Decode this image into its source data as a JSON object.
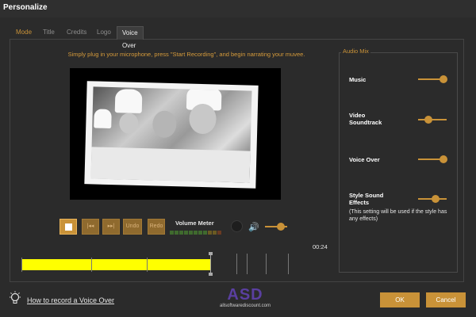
{
  "window": {
    "title": "Personalize"
  },
  "tabs": [
    {
      "label": "Mode"
    },
    {
      "label": "Title"
    },
    {
      "label": "Credits"
    },
    {
      "label": "Logo"
    },
    {
      "label": "Voice Over",
      "active": true
    }
  ],
  "instruction": "Simply plug in your microphone, press \"Start Recording\", and begin narrating your muvee.",
  "transport": {
    "buttons": [
      {
        "icon": "stop-icon",
        "label": ""
      },
      {
        "icon": "rewind-icon",
        "label": ""
      },
      {
        "icon": "forward-icon",
        "label": ""
      },
      {
        "icon": "undo-icon",
        "label": "Undo"
      },
      {
        "icon": "redo-icon",
        "label": "Redo"
      }
    ],
    "volume_meter_label": "Volume Meter",
    "volume_level": 0.7,
    "time": "00:24"
  },
  "audio_mix": {
    "title": "Audio Mix",
    "items": [
      {
        "label": "Music",
        "level": 0.9
      },
      {
        "label": "Video Soundtrack",
        "level": 0.35
      },
      {
        "label": "Voice Over",
        "level": 0.9
      },
      {
        "label": "Style Sound Effects",
        "level": 0.6
      }
    ],
    "note": "(This setting will be used if the style has any effects)"
  },
  "footer": {
    "help_link": "How to record a Voice Over",
    "watermark_big": "ASD",
    "watermark_small": "allsoftwarediscount.com",
    "ok_label": "OK",
    "cancel_label": "Cancel"
  },
  "colors": {
    "accent": "#c99238",
    "background": "#2b2b2b",
    "timeline": "#ffff00"
  }
}
